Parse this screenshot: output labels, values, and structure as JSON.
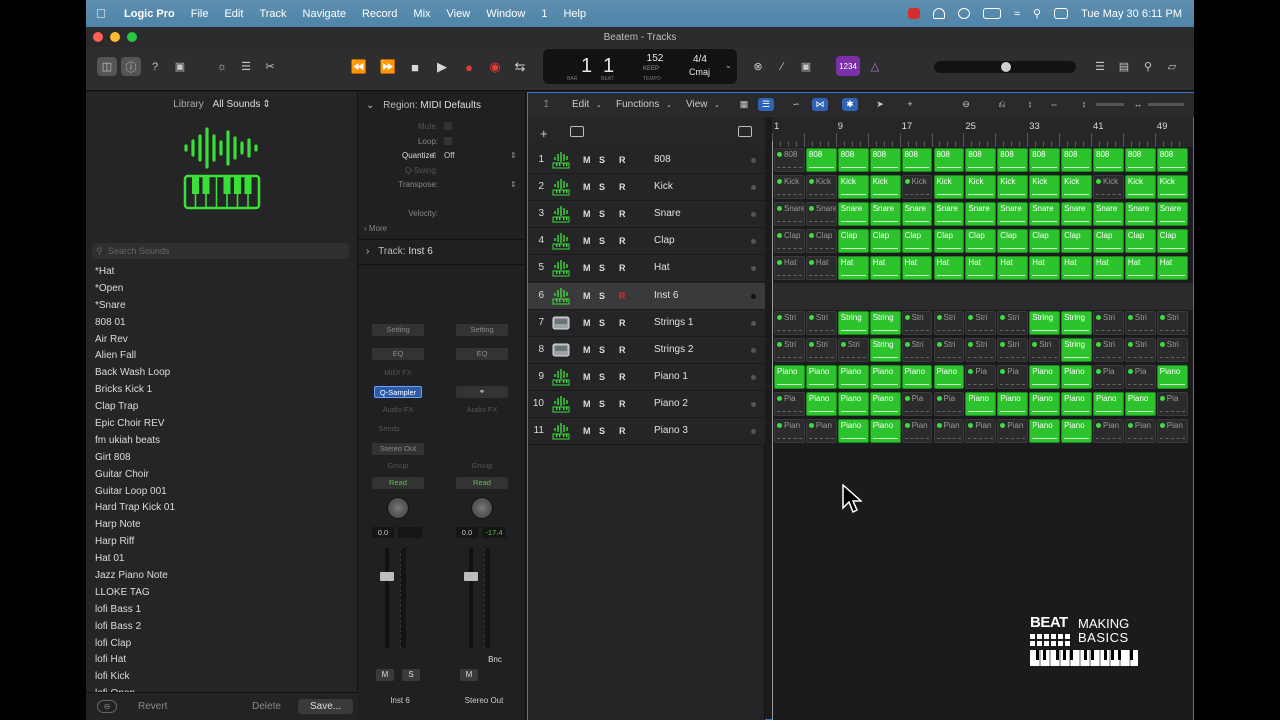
{
  "menubar": {
    "app": "Logic Pro",
    "items": [
      "File",
      "Edit",
      "Track",
      "Navigate",
      "Record",
      "Mix",
      "View",
      "Window",
      "1",
      "Help"
    ],
    "clock": "Tue May 30  6:11 PM"
  },
  "window": {
    "title": "Beatem - Tracks"
  },
  "lcd": {
    "bar": "1",
    "beat": "1",
    "tempo": "152",
    "keep": "KEEP",
    "signature": "4/4",
    "key": "Cmaj",
    "bar_label": "BAR",
    "beat_label": "BEAT",
    "tempo_label": "TEMPO"
  },
  "badge": "1234",
  "library": {
    "label": "Library",
    "filter": "All Sounds",
    "search_placeholder": "Search Sounds",
    "items": [
      "*Hat",
      "*Open",
      "*Snare",
      "808 01",
      "Air Rev",
      "Alien Fall",
      "Back Wash Loop",
      "Bricks Kick 1",
      "Clap Trap",
      "Epic Choir REV",
      "fm ukiah beats",
      "Girt 808",
      "Guitar Choir",
      "Guitar Loop 001",
      "Hard Trap Kick 01",
      "Harp Note",
      "Harp Riff",
      "Hat 01",
      "Jazz Piano Note",
      "LLOKE TAG",
      "lofi Bass 1",
      "lofi Bass 2",
      "lofi Clap",
      "lofi Hat",
      "lofi Kick",
      "lofi Open"
    ],
    "revert": "Revert",
    "delete": "Delete",
    "save": "Save..."
  },
  "inspector": {
    "region_label": "Region:",
    "region_value": "MIDI Defaults",
    "mute": "Mute:",
    "loop": "Loop:",
    "quantize": "Quantize",
    "quantize_value": "Off",
    "qswing": "Q-Swing:",
    "transpose": "Transpose:",
    "velocity": "Velocity:",
    "more": "More",
    "track_label": "Track:",
    "track_value": "Inst 6",
    "strip1": {
      "setting": "Setting",
      "eq": "EQ",
      "midifx": "MIDI FX",
      "instrument": "Q-Sampler",
      "audiofx": "Audio FX",
      "sends": "Sends",
      "output": "Stereo Out",
      "group": "Group",
      "read": "Read",
      "pan": "0.0",
      "mute": "M",
      "solo": "S",
      "name": "Inst 6"
    },
    "strip2": {
      "setting": "Setting",
      "eq": "EQ",
      "audiofx": "Audio FX",
      "group": "Group",
      "read": "Read",
      "pan": "0.0",
      "peak": "-17.4",
      "mute": "M",
      "bnc": "Bnc",
      "name": "Stereo Out"
    }
  },
  "tracks_toolbar": {
    "edit": "Edit",
    "functions": "Functions",
    "view": "View"
  },
  "ruler": [
    "1",
    "9",
    "17",
    "25",
    "33",
    "41",
    "49"
  ],
  "tracks": [
    {
      "num": "1",
      "name": "808",
      "icon": "drum-machine-icon"
    },
    {
      "num": "2",
      "name": "Kick",
      "icon": "drum-machine-icon"
    },
    {
      "num": "3",
      "name": "Snare",
      "icon": "drum-machine-icon"
    },
    {
      "num": "4",
      "name": "Clap",
      "icon": "drum-machine-icon"
    },
    {
      "num": "5",
      "name": "Hat",
      "icon": "drum-machine-icon"
    },
    {
      "num": "6",
      "name": "Inst 6",
      "icon": "drum-machine-icon"
    },
    {
      "num": "7",
      "name": "Strings 1",
      "icon": "keyboard-icon"
    },
    {
      "num": "8",
      "name": "Strings 2",
      "icon": "keyboard-icon"
    },
    {
      "num": "9",
      "name": "Piano 1",
      "icon": "drum-machine-icon"
    },
    {
      "num": "10",
      "name": "Piano 2",
      "icon": "drum-machine-icon"
    },
    {
      "num": "11",
      "name": "Piano 3",
      "icon": "drum-machine-icon"
    }
  ],
  "track_controls": {
    "mute": "M",
    "solo": "S",
    "record": "R"
  },
  "lanes": [
    {
      "label": "808",
      "states": [
        0,
        1,
        1,
        1,
        1,
        1,
        1,
        1,
        1,
        1,
        1,
        1,
        1
      ]
    },
    {
      "label": "Kick",
      "states": [
        0,
        0,
        1,
        1,
        0,
        1,
        1,
        1,
        1,
        1,
        0,
        1,
        1
      ]
    },
    {
      "label": "Snare",
      "states": [
        0,
        0,
        1,
        1,
        1,
        1,
        1,
        1,
        1,
        1,
        1,
        1,
        1
      ]
    },
    {
      "label": "Clap",
      "states": [
        0,
        0,
        1,
        1,
        1,
        1,
        1,
        1,
        1,
        1,
        1,
        1,
        1
      ]
    },
    {
      "label": "Hat",
      "states": [
        0,
        0,
        1,
        1,
        1,
        1,
        1,
        1,
        1,
        1,
        1,
        1,
        1
      ]
    },
    {
      "label": "",
      "states": []
    },
    {
      "label": "String",
      "short": "Stri",
      "states": [
        0,
        0,
        1,
        1,
        0,
        0,
        0,
        0,
        1,
        1,
        0,
        0,
        0
      ]
    },
    {
      "label": "String",
      "short": "Stri",
      "states": [
        0,
        0,
        0,
        1,
        0,
        0,
        0,
        0,
        0,
        1,
        0,
        0,
        0
      ]
    },
    {
      "label": "Piano",
      "short": "Pia",
      "states": [
        1,
        1,
        1,
        1,
        1,
        1,
        0,
        0,
        1,
        1,
        0,
        0,
        1
      ]
    },
    {
      "label": "Piano",
      "short": "Pia",
      "states": [
        0,
        1,
        1,
        1,
        0,
        0,
        1,
        1,
        1,
        1,
        1,
        1,
        0
      ]
    },
    {
      "label": "Piano",
      "short": "Pian",
      "states": [
        0,
        0,
        1,
        1,
        0,
        0,
        0,
        0,
        1,
        1,
        0,
        0,
        0
      ]
    }
  ],
  "watermark": {
    "line1": "BEAT",
    "line2": "MAKING",
    "line3": "BASICS"
  },
  "colors": {
    "region_green": "#2cc32c",
    "accent_blue": "#3478c8",
    "record_red": "#d32f2f",
    "purple": "#7b2fa8"
  }
}
